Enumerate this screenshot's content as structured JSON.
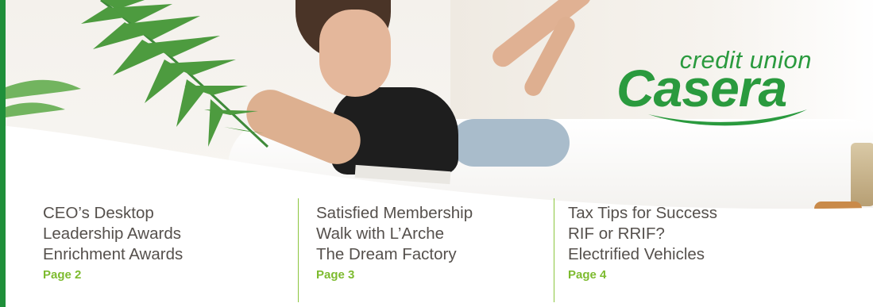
{
  "brand": {
    "top": "credit union",
    "main": "Casera",
    "color": "#2a9a3e",
    "accent_bar_color": "#1f8f3a"
  },
  "columns": [
    {
      "lines": [
        "CEO’s Desktop",
        "Leadership Awards",
        "Enrichment Awards"
      ],
      "page_label": "Page 2"
    },
    {
      "lines": [
        "Satisfied Membership",
        "Walk with L’Arche",
        "The Dream Factory"
      ],
      "page_label": "Page 3"
    },
    {
      "lines": [
        "Tax Tips for Success",
        "RIF or RRIF?",
        "Electrified Vehicles"
      ],
      "page_label": "Page 4"
    }
  ],
  "colors": {
    "text": "#55504c",
    "page_link": "#7dbb2f",
    "divider": "#8cc63f"
  }
}
